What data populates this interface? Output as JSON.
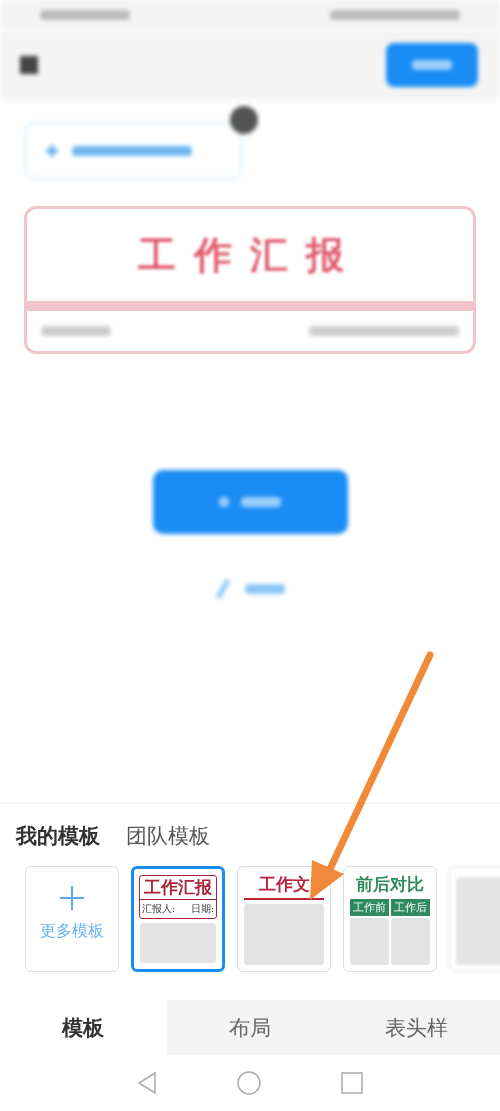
{
  "report_card": {
    "title": "工作汇报"
  },
  "template_tabs": [
    {
      "label": "我的模板",
      "selected": true
    },
    {
      "label": "团队模板",
      "selected": false
    }
  ],
  "templates": [
    {
      "kind": "more",
      "label": "更多模板",
      "selected": false
    },
    {
      "kind": "report",
      "title": "工作汇报",
      "fields": [
        "汇报人:",
        "日期:"
      ],
      "selected": true
    },
    {
      "kind": "doc",
      "title": "工作文",
      "selected": false
    },
    {
      "kind": "compare",
      "title": "前后对比",
      "columns": [
        "工作前",
        "工作后"
      ],
      "selected": false
    },
    {
      "kind": "table",
      "selected": false
    }
  ],
  "bottom_tabs": [
    {
      "label": "模板",
      "selected": true
    },
    {
      "label": "布局",
      "selected": false
    },
    {
      "label": "表头样",
      "selected": false
    }
  ]
}
